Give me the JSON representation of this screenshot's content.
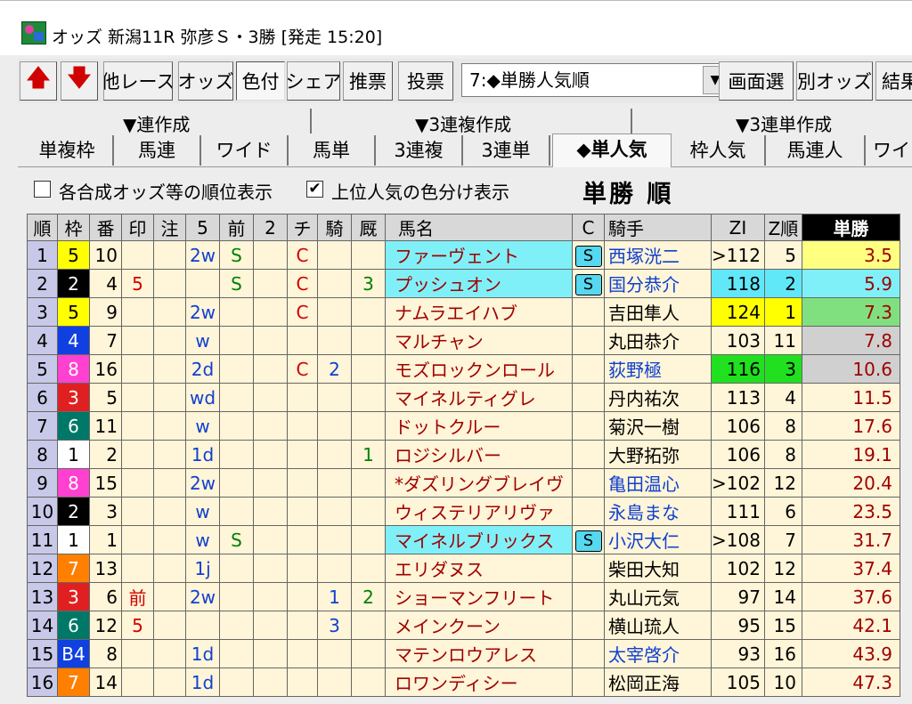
{
  "window": {
    "title": "オッズ 新潟11R 弥彦Ｓ・3勝 [発走 15:20]"
  },
  "toolbar": {
    "up_label": "🡅",
    "down_label": "🡇",
    "other_race": "他レース",
    "odds": "オッズ",
    "color": "色付",
    "share": "シェア",
    "recommend": "推票",
    "vote": "投票",
    "select_value": "7:◆単勝人気順",
    "screen_select": "画面選",
    "other_odds": "別オッズ",
    "result": "結果"
  },
  "groups": {
    "g1": "▼連作成",
    "g2": "▼3連複作成",
    "g3": "▼3連単作成"
  },
  "tabs": [
    "単複枠",
    "馬連",
    "ワイド",
    "馬単",
    "3連複",
    "3連単",
    "◆単人気",
    "枠人気",
    "馬連人",
    "ワイ"
  ],
  "active_tab": "◆単人気",
  "options": {
    "opt1_label": "各合成オッズ等の順位表示",
    "opt1_checked": "",
    "opt2_label": "上位人気の色分け表示",
    "opt2_checked": "✔",
    "heading": "単勝 順"
  },
  "columns": {
    "rank": "順",
    "waku": "枠",
    "ban": "番",
    "mark": "印",
    "note": "注",
    "five": "5",
    "zen": "前",
    "two": "2",
    "chi": "チ",
    "ki": "騎",
    "kyu": "厩",
    "name": "馬名",
    "c": "C",
    "jockey": "騎手",
    "zi": "ZI",
    "zirank": "Z順",
    "odds": "単勝"
  },
  "colors": {
    "w1": "#ffffff",
    "w2": "#000000",
    "w3": "#e02020",
    "w4": "#1040e0",
    "w5": "#ffff00",
    "w6": "#007868",
    "w7": "#ff8000",
    "w8": "#ff40d0"
  },
  "rows": [
    {
      "rank": "1",
      "waku": "5",
      "wcol": "#ffff00",
      "wfg": "#000",
      "ban": "10",
      "mark": "",
      "note": "",
      "five": "2w",
      "zen": "S",
      "two": "",
      "chi": "C",
      "ki": "",
      "kyu": "",
      "name": "ファーヴェント",
      "nbg": "#80f0f8",
      "c": "S",
      "jockey": "西塚洸二",
      "jblue": true,
      "jbg": "",
      "zi": ">112",
      "zib": "",
      "zir": "5",
      "odds": "3.5",
      "obg": "#ffff80"
    },
    {
      "rank": "2",
      "waku": "2",
      "wcol": "#000000",
      "wfg": "#fff",
      "ban": "4",
      "mark": "5",
      "note": "",
      "five": "",
      "zen": "S",
      "two": "",
      "chi": "C",
      "ki": "",
      "kyu": "3",
      "name": "プッシュオン",
      "nbg": "#80f0f8",
      "c": "S",
      "jockey": "国分恭介",
      "jblue": true,
      "jbg": "",
      "zi": "118",
      "zib": "#60e8f8",
      "zir": "2",
      "odds": "5.9",
      "obg": "#80f0f8"
    },
    {
      "rank": "3",
      "waku": "5",
      "wcol": "#ffff00",
      "wfg": "#000",
      "ban": "9",
      "mark": "",
      "note": "",
      "five": "2w",
      "zen": "",
      "two": "",
      "chi": "C",
      "ki": "",
      "kyu": "",
      "name": "ナムラエイハブ",
      "nbg": "",
      "c": "",
      "jockey": "吉田隼人",
      "jblue": false,
      "jbg": "",
      "zi": "124",
      "zib": "#ffff00",
      "zir": "1",
      "odds": "7.3",
      "obg": "#80e080"
    },
    {
      "rank": "4",
      "waku": "4",
      "wcol": "#1040e0",
      "wfg": "#fff",
      "ban": "7",
      "mark": "",
      "note": "",
      "five": "w",
      "zen": "",
      "two": "",
      "chi": "",
      "ki": "",
      "kyu": "",
      "name": "マルチャン",
      "nbg": "",
      "c": "",
      "jockey": "丸田恭介",
      "jblue": false,
      "jbg": "",
      "zi": "103",
      "zib": "",
      "zir": "11",
      "odds": "7.8",
      "obg": "#d0d0d0"
    },
    {
      "rank": "5",
      "waku": "8",
      "wcol": "#ff40d0",
      "wfg": "#fff",
      "ban": "16",
      "mark": "",
      "note": "",
      "five": "2d",
      "zen": "",
      "two": "",
      "chi": "C",
      "ki": "2",
      "kyu": "",
      "name": "モズロックンロール",
      "nbg": "",
      "c": "",
      "jockey": "荻野極",
      "jblue": true,
      "jbg": "",
      "zi": "116",
      "zib": "#20e020",
      "zir": "3",
      "odds": "10.6",
      "obg": "#d0d0d0"
    },
    {
      "rank": "6",
      "waku": "3",
      "wcol": "#e02020",
      "wfg": "#fff",
      "ban": "5",
      "mark": "",
      "note": "",
      "five": "wd",
      "zen": "",
      "two": "",
      "chi": "",
      "ki": "",
      "kyu": "",
      "name": "マイネルティグレ",
      "nbg": "",
      "c": "",
      "jockey": "丹内祐次",
      "jblue": false,
      "jbg": "",
      "zi": "113",
      "zib": "",
      "zir": "4",
      "odds": "11.5",
      "obg": ""
    },
    {
      "rank": "7",
      "waku": "6",
      "wcol": "#007868",
      "wfg": "#fff",
      "ban": "11",
      "mark": "",
      "note": "",
      "five": "w",
      "zen": "",
      "two": "",
      "chi": "",
      "ki": "",
      "kyu": "",
      "name": "ドットクルー",
      "nbg": "",
      "c": "",
      "jockey": "菊沢一樹",
      "jblue": false,
      "jbg": "",
      "zi": "106",
      "zib": "",
      "zir": "8",
      "odds": "17.6",
      "obg": ""
    },
    {
      "rank": "8",
      "waku": "1",
      "wcol": "#ffffff",
      "wfg": "#000",
      "ban": "2",
      "mark": "",
      "note": "",
      "five": "1d",
      "zen": "",
      "two": "",
      "chi": "",
      "ki": "",
      "kyu": "1",
      "name": "ロジシルバー",
      "nbg": "",
      "c": "",
      "jockey": "大野拓弥",
      "jblue": false,
      "jbg": "",
      "zi": "106",
      "zib": "",
      "zir": "8",
      "odds": "19.1",
      "obg": ""
    },
    {
      "rank": "9",
      "waku": "8",
      "wcol": "#ff40d0",
      "wfg": "#fff",
      "ban": "15",
      "mark": "",
      "note": "",
      "five": "2w",
      "zen": "",
      "two": "",
      "chi": "",
      "ki": "",
      "kyu": "",
      "name": "*ダズリングブレイヴ",
      "nbg": "",
      "c": "",
      "jockey": "亀田温心",
      "jblue": true,
      "jbg": "",
      "zi": ">102",
      "zib": "",
      "zir": "12",
      "odds": "20.4",
      "obg": ""
    },
    {
      "rank": "10",
      "waku": "2",
      "wcol": "#000000",
      "wfg": "#fff",
      "ban": "3",
      "mark": "",
      "note": "",
      "five": "w",
      "zen": "",
      "two": "",
      "chi": "",
      "ki": "",
      "kyu": "",
      "name": "ウィステリアリヴァ",
      "nbg": "",
      "c": "",
      "jockey": "永島まな",
      "jblue": true,
      "jbg": "",
      "zi": "111",
      "zib": "",
      "zir": "6",
      "odds": "23.5",
      "obg": ""
    },
    {
      "rank": "11",
      "waku": "1",
      "wcol": "#ffffff",
      "wfg": "#000",
      "ban": "1",
      "mark": "",
      "note": "",
      "five": "w",
      "zen": "S",
      "two": "",
      "chi": "",
      "ki": "",
      "kyu": "",
      "name": "マイネルブリックス",
      "nbg": "#80f0f8",
      "c": "S",
      "jockey": "小沢大仁",
      "jblue": true,
      "jbg": "",
      "zi": ">108",
      "zib": "",
      "zir": "7",
      "odds": "31.7",
      "obg": ""
    },
    {
      "rank": "12",
      "waku": "7",
      "wcol": "#ff8000",
      "wfg": "#fff",
      "ban": "13",
      "mark": "",
      "note": "",
      "five": "1j",
      "zen": "",
      "two": "",
      "chi": "",
      "ki": "",
      "kyu": "",
      "name": "エリダヌス",
      "nbg": "",
      "c": "",
      "jockey": "柴田大知",
      "jblue": false,
      "jbg": "",
      "zi": "102",
      "zib": "",
      "zir": "12",
      "odds": "37.4",
      "obg": ""
    },
    {
      "rank": "13",
      "waku": "3",
      "wcol": "#e02020",
      "wfg": "#fff",
      "ban": "6",
      "mark": "前",
      "note": "",
      "five": "2w",
      "zen": "",
      "two": "",
      "chi": "",
      "ki": "1",
      "kyu": "2",
      "name": "ショーマンフリート",
      "nbg": "",
      "c": "",
      "jockey": "丸山元気",
      "jblue": false,
      "jbg": "",
      "zi": "97",
      "zib": "",
      "zir": "14",
      "odds": "37.6",
      "obg": ""
    },
    {
      "rank": "14",
      "waku": "6",
      "wcol": "#007868",
      "wfg": "#fff",
      "ban": "12",
      "mark": "5",
      "note": "",
      "five": "",
      "zen": "",
      "two": "",
      "chi": "",
      "ki": "3",
      "kyu": "",
      "name": "メインクーン",
      "nbg": "",
      "c": "",
      "jockey": "横山琉人",
      "jblue": false,
      "jbg": "",
      "zi": "95",
      "zib": "",
      "zir": "15",
      "odds": "42.1",
      "obg": ""
    },
    {
      "rank": "15",
      "waku": "B4",
      "wcol": "#1040e0",
      "wfg": "#fff",
      "ban": "8",
      "mark": "",
      "note": "",
      "five": "1d",
      "zen": "",
      "two": "",
      "chi": "",
      "ki": "",
      "kyu": "",
      "name": "マテンロウアレス",
      "nbg": "",
      "c": "",
      "jockey": "太宰啓介",
      "jblue": true,
      "jbg": "",
      "zi": "93",
      "zib": "",
      "zir": "16",
      "odds": "43.9",
      "obg": ""
    },
    {
      "rank": "16",
      "waku": "7",
      "wcol": "#ff8000",
      "wfg": "#fff",
      "ban": "14",
      "mark": "",
      "note": "",
      "five": "1d",
      "zen": "",
      "two": "",
      "chi": "",
      "ki": "",
      "kyu": "",
      "name": "ロワンディシー",
      "nbg": "",
      "c": "",
      "jockey": "松岡正海",
      "jblue": false,
      "jbg": "",
      "zi": "105",
      "zib": "",
      "zir": "10",
      "odds": "47.3",
      "obg": ""
    }
  ]
}
